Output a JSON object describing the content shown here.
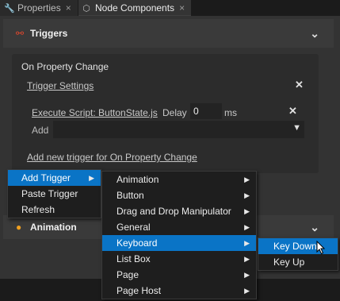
{
  "tabs": [
    {
      "label": "Properties",
      "icon": "wrench-icon",
      "close": "×"
    },
    {
      "label": "Node Components",
      "icon": "node-components-icon",
      "close": "×"
    }
  ],
  "sections": {
    "triggers": {
      "title": "Triggers",
      "icon": "link-icon"
    },
    "animation": {
      "title": "Animation",
      "icon": "animation-icon"
    }
  },
  "trigger": {
    "title": "On Property Change",
    "settings_link": "Trigger Settings",
    "action_link": "Execute Script: ButtonState.js",
    "delay_label": "Delay",
    "delay_value": "0",
    "delay_unit": "ms",
    "add_label": "Add",
    "add_new_link": "Add new trigger for On Property Change"
  },
  "context_menu": {
    "items": [
      {
        "label": "Add Trigger",
        "selected": true,
        "submenu": true
      },
      {
        "label": "Paste Trigger",
        "selected": false,
        "submenu": false
      },
      {
        "label": "Refresh",
        "selected": false,
        "submenu": false
      }
    ]
  },
  "trigger_menu": {
    "items": [
      {
        "label": "Animation",
        "selected": false
      },
      {
        "label": "Button",
        "selected": false
      },
      {
        "label": "Drag and Drop Manipulator",
        "selected": false
      },
      {
        "label": "General",
        "selected": false
      },
      {
        "label": "Keyboard",
        "selected": true
      },
      {
        "label": "List Box",
        "selected": false
      },
      {
        "label": "Page",
        "selected": false
      },
      {
        "label": "Page Host",
        "selected": false
      }
    ]
  },
  "keyboard_menu": {
    "items": [
      {
        "label": "Key Down",
        "selected": true
      },
      {
        "label": "Key Up",
        "selected": false
      }
    ]
  },
  "colors": {
    "accent": "#0a74c6",
    "trigger_icon": "#e4472c",
    "animation_icon": "#f0a020"
  }
}
